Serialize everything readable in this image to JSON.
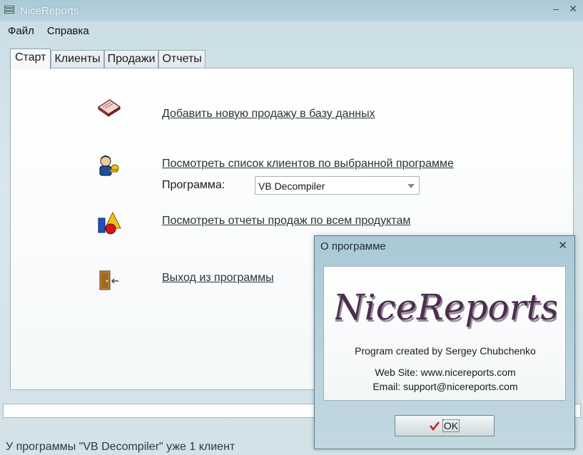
{
  "window": {
    "title": "NiceReports"
  },
  "menu": {
    "items": [
      "Файл",
      "Справка"
    ]
  },
  "tabs": [
    "Старт",
    "Клиенты",
    "Продажи",
    "Отчеты"
  ],
  "start": {
    "add_sale_link": "Добавить новую продажу в базу данных",
    "clients_link": "Посмотреть список клиентов по выбранной программе",
    "program_label": "Программа:",
    "program_value": "VB Decompiler",
    "reports_link": "Посмотреть отчеты продаж по всем продуктам",
    "exit_link": "Выход из программы"
  },
  "status": {
    "text": "У программы \"VB Decompiler\" уже 1 клиент"
  },
  "about_dialog": {
    "title": "О программе",
    "logo_text": "NiceReports",
    "created_by": "Program created by Sergey Chubchenko",
    "website": "Web Site: www.nicereports.com",
    "email": "Email: support@nicereports.com",
    "ok_label": "OK"
  }
}
